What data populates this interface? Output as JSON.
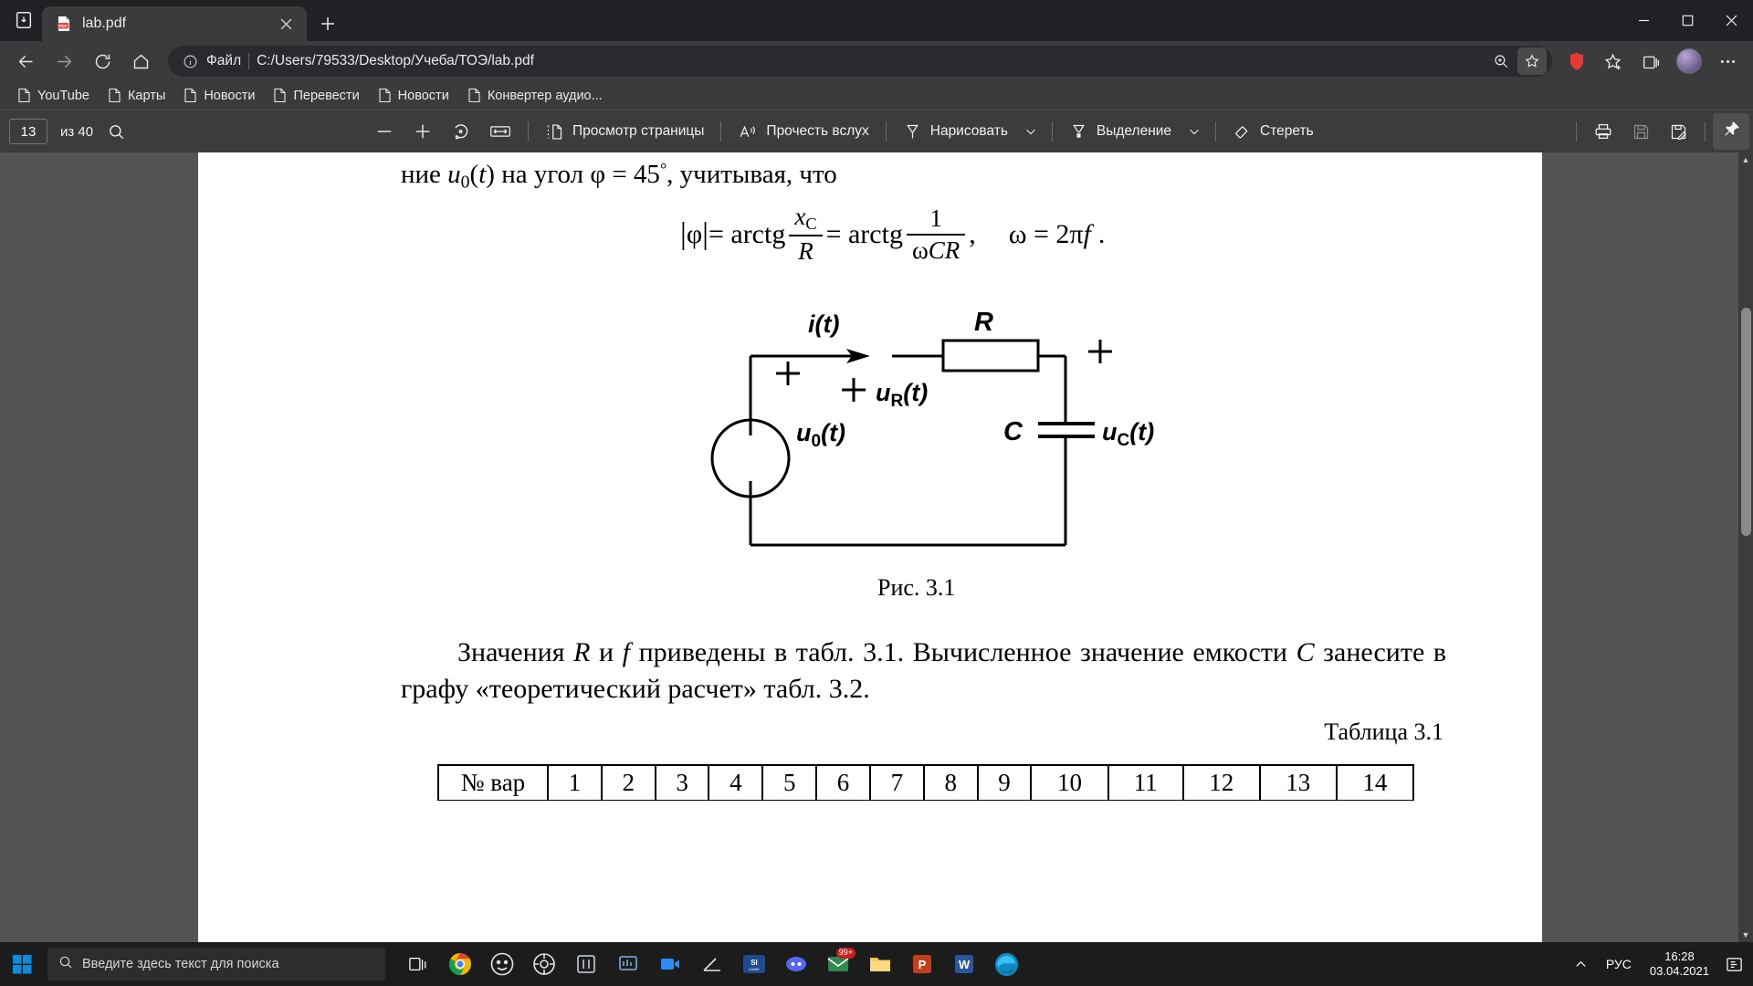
{
  "window": {
    "minimize_label": "Свернуть",
    "maximize_label": "Развернуть",
    "close_label": "Закрыть"
  },
  "tabstrip": {
    "collections_icon": "collections-icon",
    "tab": {
      "title": "lab.pdf",
      "favicon": "pdf-file-icon",
      "close_label": "×"
    },
    "new_tab_label": "+"
  },
  "navbar": {
    "back_label": "←",
    "forward_label": "→",
    "reload_label": "⟳",
    "home_label": "⌂",
    "info_icon": "info-icon",
    "file_label": "Файл",
    "url": "C:/Users/79533/Desktop/Учеба/ТОЭ/lab.pdf",
    "zoom_icon": "zoom-in-icon",
    "favorites_icon": "star-favorites-icon",
    "extension_icon": "shield-extension-icon",
    "collections_icon": "collections-icon",
    "split_icon": "split-screen-icon",
    "profile_icon": "profile-avatar",
    "more_label": "…"
  },
  "bookmarks": [
    {
      "label": "YouTube"
    },
    {
      "label": "Карты"
    },
    {
      "label": "Новости"
    },
    {
      "label": "Перевести"
    },
    {
      "label": "Новости"
    },
    {
      "label": "Конвертер аудио..."
    }
  ],
  "pdf_toolbar": {
    "current_page": "13",
    "page_count_label": "из 40",
    "search_icon": "search-icon",
    "zoom_out_label": "—",
    "zoom_in_label": "+",
    "rotate_icon": "rotate-icon",
    "fit_icon": "fit-to-width-icon",
    "page_view_label": "Просмотр страницы",
    "page_view_icon": "page-view-icon",
    "read_aloud_label": "Прочесть вслух",
    "read_aloud_icon": "read-aloud-icon",
    "draw_label": "Нарисовать",
    "draw_icon": "pen-icon",
    "draw_chevron": "chevron-down-icon",
    "highlight_label": "Выделение",
    "highlight_icon": "highlighter-icon",
    "highlight_chevron": "chevron-down-icon",
    "erase_label": "Стереть",
    "erase_icon": "eraser-icon",
    "print_icon": "print-icon",
    "save_icon": "save-icon",
    "save_as_icon": "save-as-icon",
    "pin_icon": "pin-icon"
  },
  "document": {
    "line1": {
      "before": "ние ",
      "u": "u",
      "u_sub": "0",
      "paren_open": "(",
      "t": "t",
      "paren_close": ")",
      "middle": " на угол φ = 45",
      "degree": "°",
      "after": ", учитывая, что"
    },
    "formula": {
      "bar_open": "|",
      "phi": "φ",
      "bar_close": "|",
      "eq1": " = arctg",
      "frac1_num_x": "x",
      "frac1_num_sub": "C",
      "frac1_den": "R",
      "eq2": " = arctg",
      "frac2_num": "1",
      "frac2_den_omega": "ω",
      "frac2_den_cr": "CR",
      "comma": ",",
      "omega_eq": "ω = 2π",
      "f": "f",
      "period": "."
    },
    "circuit": {
      "current_label": "i(t)",
      "resistor_label": "R",
      "u_r_label": "uR(t)",
      "u_r_plain": "u",
      "u_r_sub": "R",
      "u_r_tail": "(t)",
      "source_label": "u0(t)",
      "source_plain": "u",
      "source_sub": "0",
      "source_tail": "(t)",
      "capacitor_label": "C",
      "u_c_plain": "u",
      "u_c_sub": "C",
      "u_c_tail": "(t)",
      "plus_source": "+",
      "plus_resistor": "+",
      "plus_capacitor": "+"
    },
    "figure_caption": "Рис. 3.1",
    "paragraph": {
      "part1": "Значения ",
      "italic_R": "R",
      "part2": " и ",
      "italic_f": "f",
      "part3": " приведены в табл. 3.1. Вычисленное значение емкости ",
      "italic_C": "C",
      "part4": " занесите в графу «теоретический расчет» табл. 3.2."
    },
    "table_caption": "Таблица 3.1",
    "table": {
      "header_label": "№ вар",
      "columns": [
        "1",
        "2",
        "3",
        "4",
        "5",
        "6",
        "7",
        "8",
        "9",
        "10",
        "11",
        "12",
        "13",
        "14"
      ]
    }
  },
  "taskbar": {
    "start_icon": "windows-start-icon",
    "search_placeholder": "Введите здесь текст для поиска",
    "search_icon": "search-icon",
    "task_view_icon": "task-view-icon",
    "apps": [
      {
        "name": "chrome-icon"
      },
      {
        "name": "compass-app-icon"
      },
      {
        "name": "settings-gear-icon"
      },
      {
        "name": "app-window-icon"
      },
      {
        "name": "presentation-app-icon"
      },
      {
        "name": "video-app-icon"
      },
      {
        "name": "graph-app-icon"
      },
      {
        "name": "si-game-icon",
        "label": "SI"
      },
      {
        "name": "discord-icon"
      },
      {
        "name": "mail-icon",
        "badge": "99+"
      },
      {
        "name": "file-explorer-icon"
      },
      {
        "name": "powerpoint-icon",
        "label": "P"
      },
      {
        "name": "word-icon",
        "label": "W"
      },
      {
        "name": "edge-icon"
      }
    ],
    "tray": {
      "chevron_icon": "chevron-up-icon",
      "language": "РУС",
      "time": "16:28",
      "date": "03.04.2021",
      "notifications_icon": "notification-icon"
    }
  },
  "colors": {
    "browser_chrome": "#3b3b3e",
    "tab_strip": "#202124",
    "pdf_toolbar": "#3c3c3c",
    "viewport": "#545454",
    "page": "#ffffff",
    "taskbar": "#1c1c1c",
    "accent_red": "#e53935",
    "badge_red": "#c5221f"
  }
}
